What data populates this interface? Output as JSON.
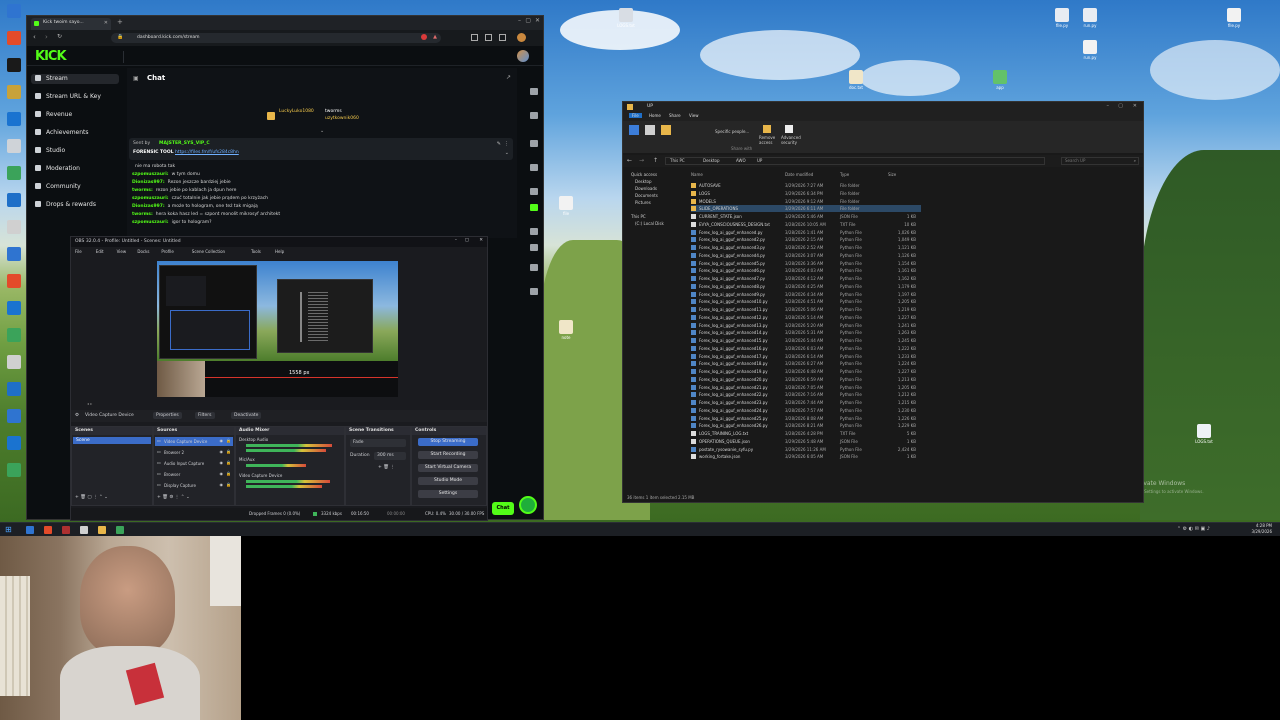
{
  "browser": {
    "tab_title": "Kick twoim sayo...",
    "url": "dashboard.kick.com/stream",
    "logo": "KICK",
    "nav": [
      {
        "label": "Stream",
        "active": true
      },
      {
        "label": "Stream URL & Key"
      },
      {
        "label": "Revenue"
      },
      {
        "label": "Achievements"
      },
      {
        "label": "Studio"
      },
      {
        "label": "Moderation"
      },
      {
        "label": "Community"
      },
      {
        "label": "Drops & rewards"
      }
    ],
    "chat": {
      "title": "Chat",
      "top_users": [
        "LuckyLuko1080",
        "tworms",
        "uzytkownik060"
      ],
      "pinned_sender": "Sent by",
      "pinned_user": "MAJSTER_SYS_VIP_C",
      "pinned_label": "FORENSIC TOOL",
      "pinned_link": "https://files.fm/f/ufs284c8hn",
      "messages": [
        {
          "user": "",
          "text": "nie ma robota tak"
        },
        {
          "user": "szpomuszauri:",
          "text": "w tym domu"
        },
        {
          "user": "Dionizas997:",
          "text": "Rezon jeszcze bardziej jebie"
        },
        {
          "user": "tworms:",
          "text": "rezon jebie po kablach ja dpun here"
        },
        {
          "user": "szpomuszauri:",
          "text": "czuć totalnie jak jebie prądem po krzyżach"
        },
        {
          "user": "Dionizas997:",
          "text": "a może to hologram, one też tak migają"
        },
        {
          "user": "tworms:",
          "text": "hera koka hasz led = szpont monolit mikrosyf architekt"
        },
        {
          "user": "szpomuszauri:",
          "text": "igor to hologram?"
        }
      ],
      "chat_button": "Chat"
    }
  },
  "obs": {
    "title": "OBS 32.0.4 - Profile: Untitled - Scenes: Untitled",
    "menu": [
      "File",
      "Edit",
      "View",
      "Docks",
      "Profile",
      "Scene Collection",
      "Tools",
      "Help"
    ],
    "preview_fps": "1558 px",
    "source_toolbar": {
      "device": "Video Capture Device",
      "properties": "Properties",
      "filters": "Filters",
      "deactivate": "Deactivate"
    },
    "docks": {
      "scenes": {
        "title": "Scenes",
        "items": [
          "Scene"
        ]
      },
      "sources": {
        "title": "Sources",
        "items": [
          "Video Capture Device",
          "Browser 2",
          "Audio Input Capture",
          "Browser",
          "Display Capture"
        ]
      },
      "mixer": {
        "title": "Audio Mixer",
        "channels": [
          "Desktop Audio",
          "Mic/Aux",
          "Video Capture Device"
        ]
      },
      "transitions": {
        "title": "Scene Transitions",
        "type": "Fade",
        "duration_label": "Duration",
        "duration": "300 ms"
      },
      "controls": {
        "title": "Controls",
        "buttons": [
          "Stop Streaming",
          "Start Recording",
          "Start Virtual Camera",
          "Studio Mode",
          "Settings"
        ]
      }
    },
    "status": {
      "dropped": "Dropped Frames 0 (0.0%)",
      "bitrate": "3324 kbps",
      "live_time": "00:16:50",
      "rec_time": "00:00:00",
      "cpu": "CPU: 0.4%",
      "fps": "30.00 / 30.00 FPS"
    }
  },
  "explorer": {
    "title": "UP",
    "ribbon_tabs": [
      "File",
      "Home",
      "Share",
      "View"
    ],
    "ribbon_items": [
      "Pin to Quick access",
      "Copy",
      "Paste",
      "Specific people...",
      "Remove access",
      "Advanced security"
    ],
    "ribbon_group": "Share with",
    "path": [
      "This PC",
      "Desktop",
      "AWO",
      "UP"
    ],
    "search_placeholder": "Search UP",
    "side": [
      "Quick access",
      "Desktop",
      "Downloads",
      "Documents",
      "Pictures",
      "This PC",
      "(C:) Local Disk"
    ],
    "columns": [
      "Name",
      "Date modified",
      "Type",
      "Size"
    ],
    "files": [
      {
        "name": "AUTOSAVE",
        "date": "3/29/2026 7:27 AM",
        "type": "File folder",
        "size": "",
        "folder": true
      },
      {
        "name": "LOGS",
        "date": "3/29/2026 6:34 PM",
        "type": "File folder",
        "size": "",
        "folder": true
      },
      {
        "name": "MODELS",
        "date": "3/29/2026 9:12 AM",
        "type": "File folder",
        "size": "",
        "folder": true
      },
      {
        "name": "SLIDE_OPERATIONS",
        "date": "3/29/2026 6:11 AM",
        "type": "File folder",
        "size": "",
        "folder": true,
        "selected": true
      },
      {
        "name": "CURRENT_STATE.json",
        "date": "3/29/2026 5:46 AM",
        "type": "JSON File",
        "size": "1 KB"
      },
      {
        "name": "EVYA_CONSCIOUSNESS_DESIGN.txt",
        "date": "3/28/2026 10:05 AM",
        "type": "TXT File",
        "size": "10 KB"
      },
      {
        "name": "Forex_log_ai_gguf_enhanced.py",
        "date": "3/28/2026 1:41 AM",
        "type": "Python File",
        "size": "1,026 KB"
      },
      {
        "name": "Forex_log_ai_gguf_enhanced2.py",
        "date": "3/28/2026 2:15 AM",
        "type": "Python File",
        "size": "1,049 KB"
      },
      {
        "name": "Forex_log_ai_gguf_enhanced3.py",
        "date": "3/28/2026 2:52 AM",
        "type": "Python File",
        "size": "1,121 KB"
      },
      {
        "name": "Forex_log_ai_gguf_enhanced4.py",
        "date": "3/28/2026 3:07 AM",
        "type": "Python File",
        "size": "1,126 KB"
      },
      {
        "name": "Forex_log_ai_gguf_enhanced5.py",
        "date": "3/28/2026 3:36 AM",
        "type": "Python File",
        "size": "1,154 KB"
      },
      {
        "name": "Forex_log_ai_gguf_enhanced6.py",
        "date": "3/28/2026 4:03 AM",
        "type": "Python File",
        "size": "1,161 KB"
      },
      {
        "name": "Forex_log_ai_gguf_enhanced7.py",
        "date": "3/28/2026 4:12 AM",
        "type": "Python File",
        "size": "1,162 KB"
      },
      {
        "name": "Forex_log_ai_gguf_enhanced8.py",
        "date": "3/28/2026 4:25 AM",
        "type": "Python File",
        "size": "1,179 KB"
      },
      {
        "name": "Forex_log_ai_gguf_enhanced9.py",
        "date": "3/28/2026 4:34 AM",
        "type": "Python File",
        "size": "1,197 KB"
      },
      {
        "name": "Forex_log_ai_gguf_enhanced10.py",
        "date": "3/28/2026 4:51 AM",
        "type": "Python File",
        "size": "1,205 KB"
      },
      {
        "name": "Forex_log_ai_gguf_enhanced11.py",
        "date": "3/28/2026 5:06 AM",
        "type": "Python File",
        "size": "1,219 KB"
      },
      {
        "name": "Forex_log_ai_gguf_enhanced12.py",
        "date": "3/28/2026 5:14 AM",
        "type": "Python File",
        "size": "1,227 KB"
      },
      {
        "name": "Forex_log_ai_gguf_enhanced13.py",
        "date": "3/28/2026 5:20 AM",
        "type": "Python File",
        "size": "1,241 KB"
      },
      {
        "name": "Forex_log_ai_gguf_enhanced14.py",
        "date": "3/28/2026 5:31 AM",
        "type": "Python File",
        "size": "1,263 KB"
      },
      {
        "name": "Forex_log_ai_gguf_enhanced15.py",
        "date": "3/28/2026 5:44 AM",
        "type": "Python File",
        "size": "1,245 KB"
      },
      {
        "name": "Forex_log_ai_gguf_enhanced16.py",
        "date": "3/28/2026 6:03 AM",
        "type": "Python File",
        "size": "1,222 KB"
      },
      {
        "name": "Forex_log_ai_gguf_enhanced17.py",
        "date": "3/28/2026 6:14 AM",
        "type": "Python File",
        "size": "1,233 KB"
      },
      {
        "name": "Forex_log_ai_gguf_enhanced18.py",
        "date": "3/28/2026 6:27 AM",
        "type": "Python File",
        "size": "1,224 KB"
      },
      {
        "name": "Forex_log_ai_gguf_enhanced19.py",
        "date": "3/28/2026 6:48 AM",
        "type": "Python File",
        "size": "1,227 KB"
      },
      {
        "name": "Forex_log_ai_gguf_enhanced20.py",
        "date": "3/28/2026 6:59 AM",
        "type": "Python File",
        "size": "1,213 KB"
      },
      {
        "name": "Forex_log_ai_gguf_enhanced21.py",
        "date": "3/28/2026 7:05 AM",
        "type": "Python File",
        "size": "1,205 KB"
      },
      {
        "name": "Forex_log_ai_gguf_enhanced22.py",
        "date": "3/28/2026 7:16 AM",
        "type": "Python File",
        "size": "1,212 KB"
      },
      {
        "name": "Forex_log_ai_gguf_enhanced23.py",
        "date": "3/28/2026 7:44 AM",
        "type": "Python File",
        "size": "1,215 KB"
      },
      {
        "name": "Forex_log_ai_gguf_enhanced24.py",
        "date": "3/28/2026 7:57 AM",
        "type": "Python File",
        "size": "1,230 KB"
      },
      {
        "name": "Forex_log_ai_gguf_enhanced25.py",
        "date": "3/28/2026 8:08 AM",
        "type": "Python File",
        "size": "1,226 KB"
      },
      {
        "name": "Forex_log_ai_gguf_enhanced26.py",
        "date": "3/28/2026 8:21 AM",
        "type": "Python File",
        "size": "1,229 KB"
      },
      {
        "name": "LOGS_TRAINING_LOG.txt",
        "date": "3/28/2026 4:28 PM",
        "type": "TXT File",
        "size": "5 KB"
      },
      {
        "name": "OPERATIONS_QUEUE.json",
        "date": "3/29/2026 5:48 AM",
        "type": "JSON File",
        "size": "1 KB"
      },
      {
        "name": "postate_rysowanie_syfu.py",
        "date": "3/29/2026 11:26 AM",
        "type": "Python File",
        "size": "2,424 KB"
      },
      {
        "name": "working_fortake.json",
        "date": "3/29/2026 6:05 AM",
        "type": "JSON File",
        "size": "1 KB"
      }
    ],
    "status": "36 items   1 item selected  2.15 MB"
  },
  "desktop": {
    "watermark_title": "Activate Windows",
    "watermark_sub": "Go to Settings to activate Windows.",
    "clock_time": "4:28 PM",
    "clock_date": "3/29/2026"
  },
  "colors": {
    "kick_green": "#53fc18",
    "obs_blue": "#3b6cc8",
    "explorer_bg": "#191919",
    "folder": "#e8b64a",
    "python": "#4f86c6"
  }
}
